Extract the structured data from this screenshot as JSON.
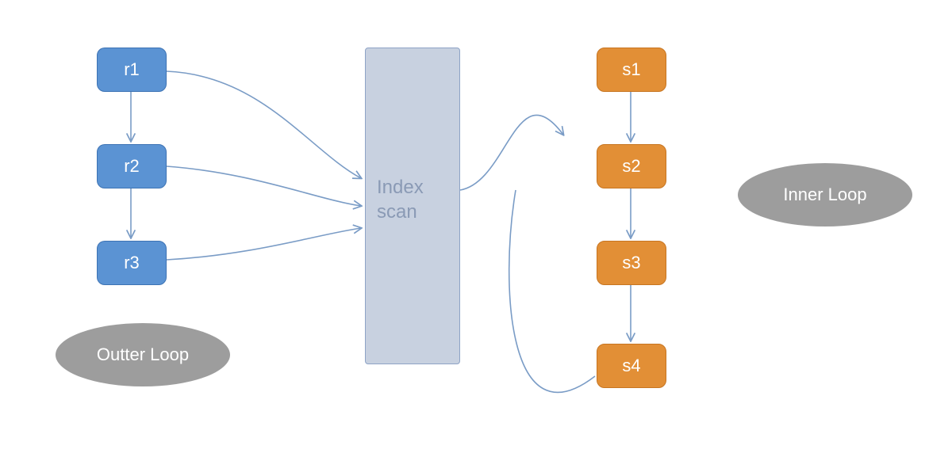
{
  "diagram": {
    "r_nodes": [
      "r1",
      "r2",
      "r3"
    ],
    "s_nodes": [
      "s1",
      "s2",
      "s3",
      "s4"
    ],
    "index_label_line1": "Index",
    "index_label_line2": "scan",
    "outer_loop_label": "Outter Loop",
    "inner_loop_label": "Inner Loop",
    "colors": {
      "r_fill": "#5b93d3",
      "s_fill": "#e28f36",
      "index_fill": "#c8d1e0",
      "ellipse_fill": "#9d9d9d",
      "arrow": "#7a9cc6"
    }
  }
}
